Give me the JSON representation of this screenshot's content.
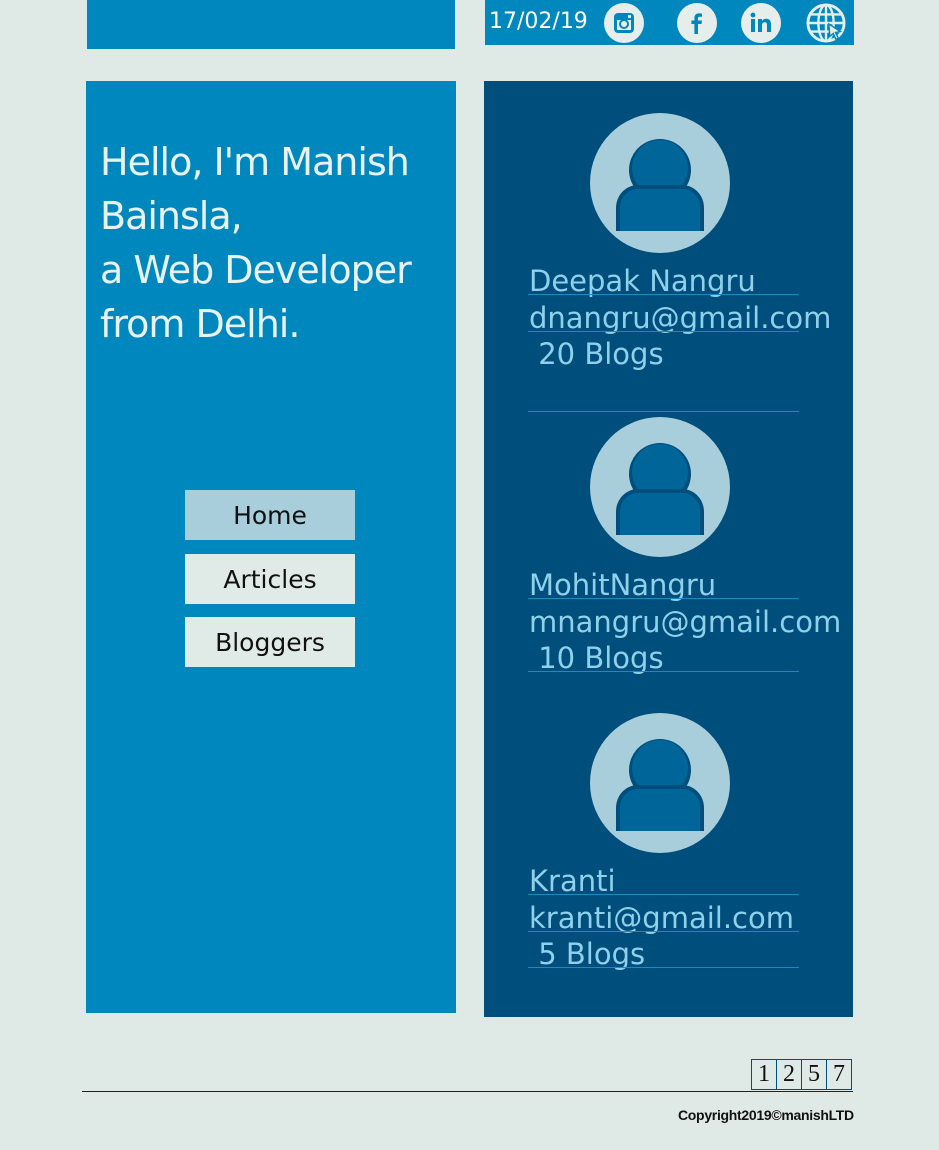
{
  "header": {
    "date": "17/02/19",
    "social_icons": [
      "instagram-icon",
      "facebook-icon",
      "linkedin-icon",
      "globe-icon"
    ]
  },
  "intro": {
    "line1": "Hello, I'm Manish Bainsla,",
    "line2": "a Web Developer from Delhi."
  },
  "nav": {
    "home": "Home",
    "articles": "Articles",
    "bloggers": "Bloggers",
    "active": "Home"
  },
  "bloggers": [
    {
      "name": "Deepak Nangru",
      "email": "dnangru@gmail.com",
      "blogs": " 20 Blogs"
    },
    {
      "name": "MohitNangru",
      "email": "mnangru@gmail.com",
      "blogs": " 10 Blogs"
    },
    {
      "name": "Kranti",
      "email": "kranti@gmail.com",
      "blogs": " 5 Blogs"
    }
  ],
  "pagination": [
    "1",
    "2",
    "5",
    "7"
  ],
  "footer": {
    "copyright": "Copyright2019©manishLTD"
  },
  "colors": {
    "background": "#dfe9e5",
    "primary_blue": "#0088be",
    "dark_blue": "#004e7c",
    "avatar_light": "#a8cddb",
    "blogger_text": "#8fd0ea"
  }
}
